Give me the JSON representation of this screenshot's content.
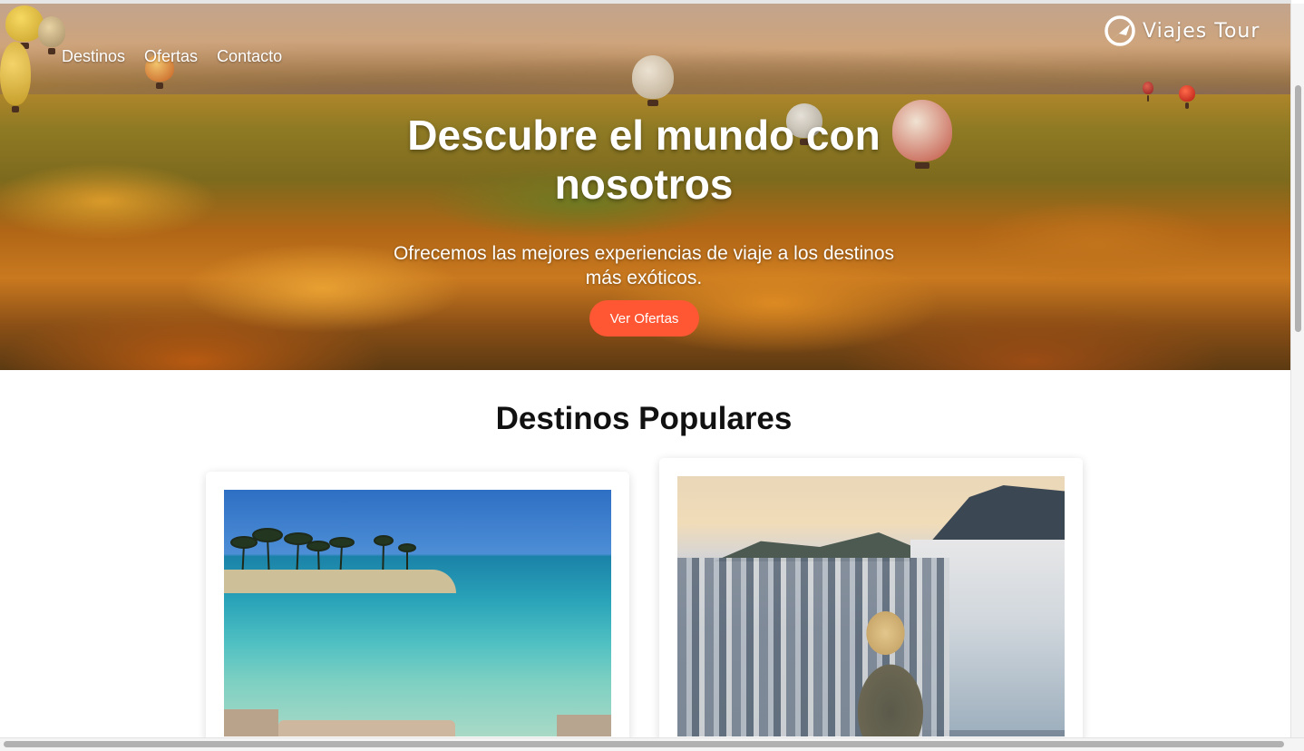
{
  "nav": {
    "items": [
      {
        "label": "Destinos"
      },
      {
        "label": "Ofertas"
      },
      {
        "label": "Contacto"
      }
    ]
  },
  "brand": {
    "name": "Viajes Tour",
    "icon": "globe-plane-icon"
  },
  "hero": {
    "title": "Descubre el mundo con nosotros",
    "subtitle": "Ofrecemos las mejores experiencias de viaje a los destinos más exóticos.",
    "cta_label": "Ver Ofertas",
    "cta_color": "#ff5733"
  },
  "popular": {
    "title": "Destinos Populares",
    "cards": [
      {
        "image": "beach-image"
      },
      {
        "image": "coastal-city-image"
      }
    ]
  }
}
